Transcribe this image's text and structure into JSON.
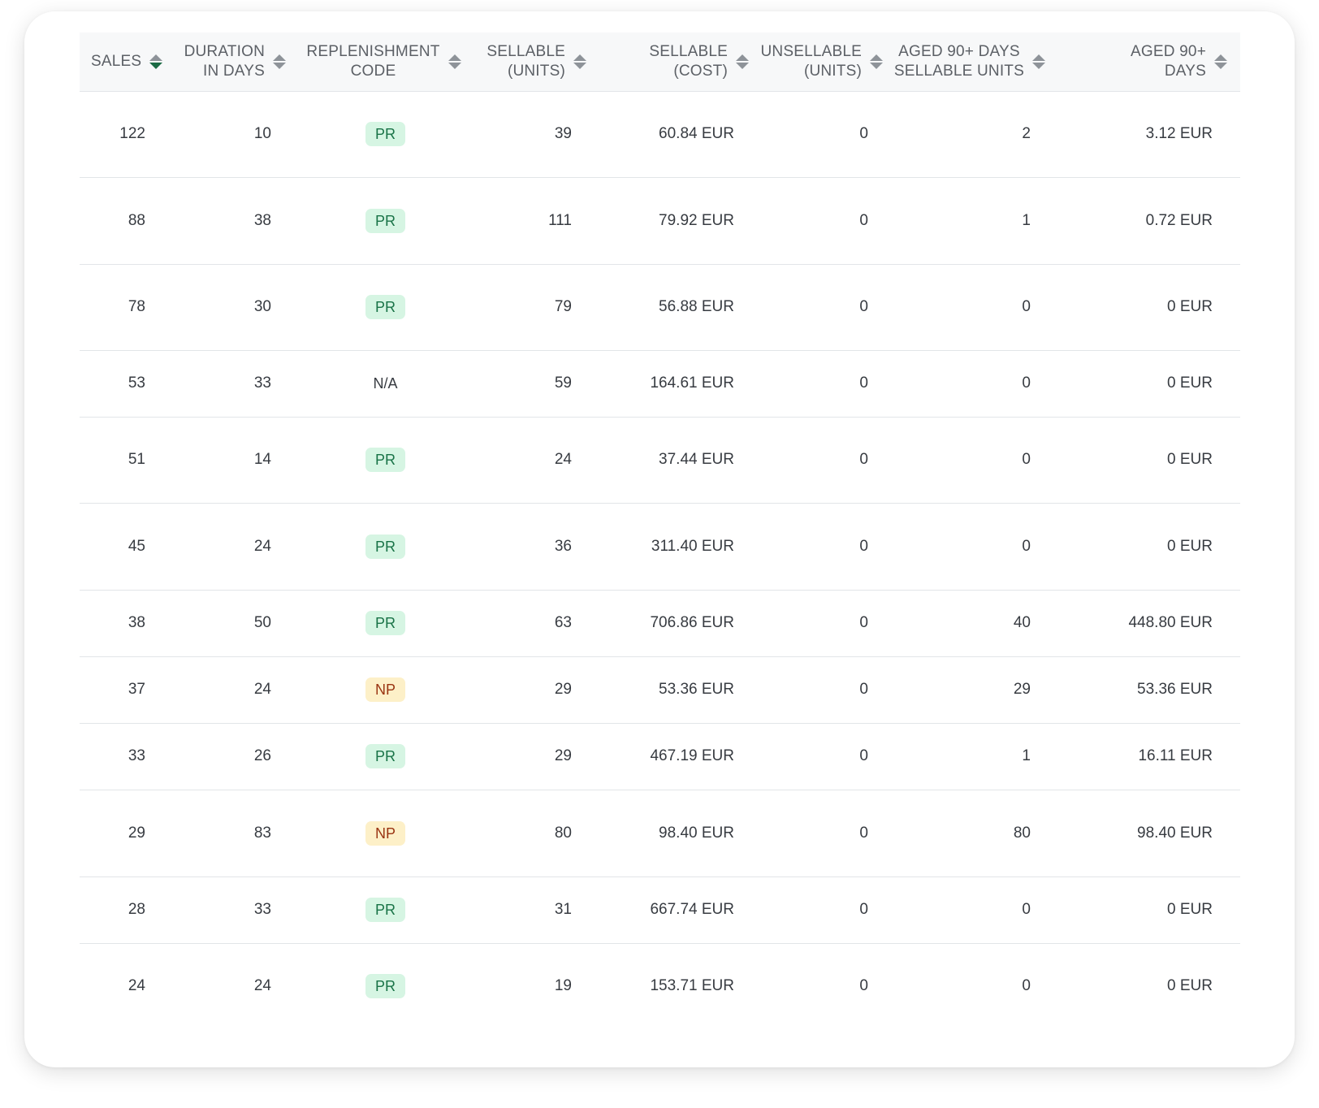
{
  "table": {
    "columns": [
      {
        "label": "SALES",
        "sort": "desc-active"
      },
      {
        "label": "DURATION IN DAYS",
        "line1": "DURATION",
        "line2": "IN DAYS"
      },
      {
        "label": "REPLENISHMENT CODE",
        "line1": "REPLENISHMENT",
        "line2": "CODE"
      },
      {
        "label": "SELLABLE (UNITS)",
        "line1": "SELLABLE",
        "line2": "(UNITS)"
      },
      {
        "label": "SELLABLE (COST)",
        "line1": "SELLABLE",
        "line2": "(COST)"
      },
      {
        "label": "UNSELLABLE (UNITS)",
        "line1": "UNSELLABLE",
        "line2": "(UNITS)"
      },
      {
        "label": "AGED 90+ DAYS SELLABLE UNITS",
        "line1": "AGED 90+ DAYS",
        "line2": "SELLABLE UNITS"
      },
      {
        "label": "AGED 90+ DAYS",
        "line1": "AGED 90+",
        "line2": "DAYS"
      }
    ],
    "rows": [
      {
        "sales": "122",
        "duration": "10",
        "code": "PR",
        "sellable_units": "39",
        "sellable_cost": "60.84 EUR",
        "unsellable_units": "0",
        "aged_units": "2",
        "aged_cost": "3.12 EUR"
      },
      {
        "sales": "88",
        "duration": "38",
        "code": "PR",
        "sellable_units": "111",
        "sellable_cost": "79.92 EUR",
        "unsellable_units": "0",
        "aged_units": "1",
        "aged_cost": "0.72 EUR"
      },
      {
        "sales": "78",
        "duration": "30",
        "code": "PR",
        "sellable_units": "79",
        "sellable_cost": "56.88 EUR",
        "unsellable_units": "0",
        "aged_units": "0",
        "aged_cost": "0 EUR"
      },
      {
        "sales": "53",
        "duration": "33",
        "code": "N/A",
        "sellable_units": "59",
        "sellable_cost": "164.61 EUR",
        "unsellable_units": "0",
        "aged_units": "0",
        "aged_cost": "0 EUR"
      },
      {
        "sales": "51",
        "duration": "14",
        "code": "PR",
        "sellable_units": "24",
        "sellable_cost": "37.44 EUR",
        "unsellable_units": "0",
        "aged_units": "0",
        "aged_cost": "0 EUR"
      },
      {
        "sales": "45",
        "duration": "24",
        "code": "PR",
        "sellable_units": "36",
        "sellable_cost": "311.40 EUR",
        "unsellable_units": "0",
        "aged_units": "0",
        "aged_cost": "0 EUR"
      },
      {
        "sales": "38",
        "duration": "50",
        "code": "PR",
        "sellable_units": "63",
        "sellable_cost": "706.86 EUR",
        "unsellable_units": "0",
        "aged_units": "40",
        "aged_cost": "448.80 EUR"
      },
      {
        "sales": "37",
        "duration": "24",
        "code": "NP",
        "sellable_units": "29",
        "sellable_cost": "53.36 EUR",
        "unsellable_units": "0",
        "aged_units": "29",
        "aged_cost": "53.36 EUR"
      },
      {
        "sales": "33",
        "duration": "26",
        "code": "PR",
        "sellable_units": "29",
        "sellable_cost": "467.19 EUR",
        "unsellable_units": "0",
        "aged_units": "1",
        "aged_cost": "16.11 EUR"
      },
      {
        "sales": "29",
        "duration": "83",
        "code": "NP",
        "sellable_units": "80",
        "sellable_cost": "98.40 EUR",
        "unsellable_units": "0",
        "aged_units": "80",
        "aged_cost": "98.40 EUR"
      },
      {
        "sales": "28",
        "duration": "33",
        "code": "PR",
        "sellable_units": "31",
        "sellable_cost": "667.74 EUR",
        "unsellable_units": "0",
        "aged_units": "0",
        "aged_cost": "0 EUR"
      },
      {
        "sales": "24",
        "duration": "24",
        "code": "PR",
        "sellable_units": "19",
        "sellable_cost": "153.71 EUR",
        "unsellable_units": "0",
        "aged_units": "0",
        "aged_cost": "0 EUR"
      }
    ],
    "badge_colors": {
      "PR": {
        "bg": "#d6f5e3",
        "fg": "#197347"
      },
      "NP": {
        "bg": "#fdf0c8",
        "fg": "#9a3412"
      }
    },
    "sort_icon": "sort-up-down-icon",
    "active_sort_color": "#1b6b45"
  }
}
